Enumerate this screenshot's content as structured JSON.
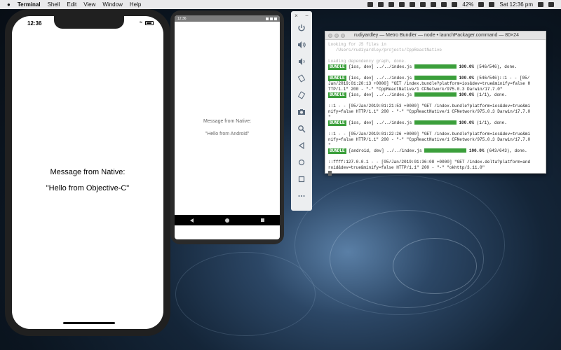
{
  "menubar": {
    "apple": "",
    "app": "Terminal",
    "items": [
      "Shell",
      "Edit",
      "View",
      "Window",
      "Help"
    ],
    "battery": "42%",
    "clock": "Sat 12:36 pm"
  },
  "iphone": {
    "time": "12:36",
    "message_label": "Message from Native:",
    "message_value": "\"Hello from Objective-C\""
  },
  "android": {
    "time": "12:36",
    "message_label": "Message from Native:",
    "message_value": "\"Hello from Android\""
  },
  "emulator_toolbar": {
    "close": "×",
    "minimize": "−",
    "tools": [
      "power-icon",
      "volume-up-icon",
      "volume-down-icon",
      "rotate-left-icon",
      "rotate-right-icon",
      "camera-icon",
      "zoom-icon",
      "back-icon",
      "home-icon",
      "overview-icon",
      "more-icon"
    ]
  },
  "terminal": {
    "title": "rudiyardley — Metro Bundler — node • launchPackager.command — 80×24",
    "lines": {
      "l1": "Looking for JS files in",
      "l2": "   /Users/rudiyardley/projects/CppReactNative",
      "l3": "Loading dependency graph, done.",
      "b1_tag": "BUNDLE",
      "b1_text": " [ios, dev] ../../index.js ",
      "b1_pct": "100.0%",
      "b1_tail": " (546/546), done.",
      "b2_tag": "BUNDLE",
      "b2_text": " [ios, dev] ../../index.js ",
      "b2_pct": "100.0%",
      "b2_tail": " (546/546)::1 - - [05/",
      "l4": "Jan/2019:01:20:13 +0000] \"GET /index.bundle?platform=ios&dev=true&minify=false H",
      "l5": "TTP/1.1\" 200 - \"-\" \"CppReactNative/1 CFNetwork/975.0.3 Darwin/17.7.0\"",
      "b3_tag": "BUNDLE",
      "b3_text": " [ios, dev] ../../index.js ",
      "b3_pct": "100.0%",
      "b3_tail": " (1/1), done.",
      "l6": "::1 - - [05/Jan/2019:01:21:53 +0000] \"GET /index.bundle?platform=ios&dev=true&mi",
      "l7": "nify=false HTTP/1.1\" 200 - \"-\" \"CppReactNative/1 CFNetwork/975.0.3 Darwin/17.7.0",
      "l7b": "\"",
      "b4_tag": "BUNDLE",
      "b4_text": " [ios, dev] ../../index.js ",
      "b4_pct": "100.0%",
      "b4_tail": " (1/1), done.",
      "l8": "::1 - - [05/Jan/2019:01:22:26 +0000] \"GET /index.bundle?platform=ios&dev=true&mi",
      "l9": "nify=false HTTP/1.1\" 200 - \"-\" \"CppReactNative/1 CFNetwork/975.0.3 Darwin/17.7.0",
      "l9b": "\"",
      "b5_tag": "BUNDLE",
      "b5_text": " [android, dev] ../../index.js ",
      "b5_pct": "100.0%",
      "b5_tail": " (643/643), done.",
      "l10": "::ffff:127.0.0.1 - - [05/Jan/2019:01:36:08 +0000] \"GET /index.delta?platform=and",
      "l11": "roid&dev=true&minify=false HTTP/1.1\" 200 - \"-\" \"okhttp/3.11.0\""
    }
  },
  "colors": {
    "bundle_green": "#3b9f3b",
    "emulator_icon": "#5a6a7c"
  }
}
